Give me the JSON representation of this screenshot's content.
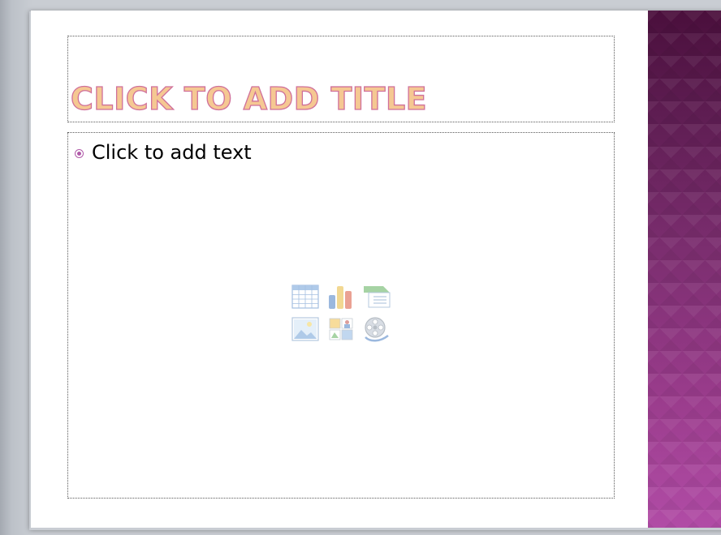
{
  "slide": {
    "title_placeholder": "CLICK TO ADD TITLE",
    "body_placeholder": "Click to add text",
    "insert_icons": [
      "insert-table-icon",
      "insert-chart-icon",
      "insert-smartart-icon",
      "insert-picture-icon",
      "insert-clip-art-icon",
      "insert-media-clip-icon"
    ]
  },
  "theme": {
    "title_fill": "#f5c892",
    "title_outline": "#d0709a",
    "bullet_color": "#b05aa8",
    "band_top": "#4a0f3c",
    "band_bottom": "#b14ca6"
  }
}
